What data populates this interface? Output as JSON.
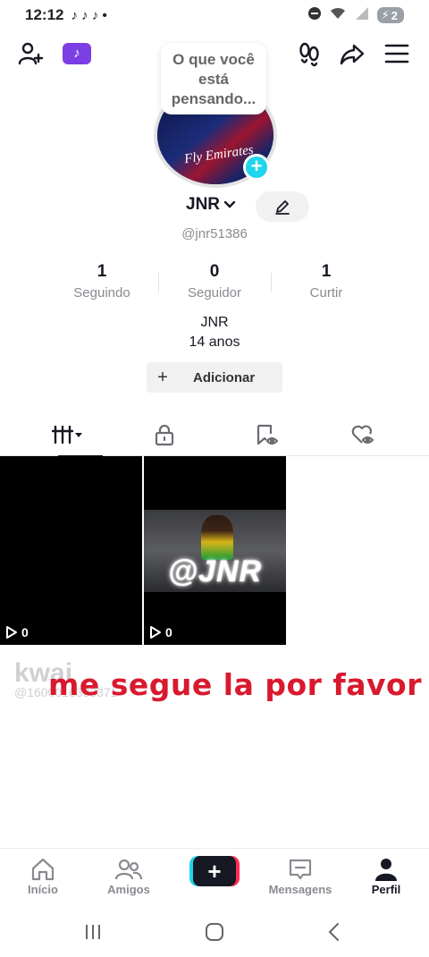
{
  "status_bar": {
    "time": "12:12",
    "notif_icons": "♪ ♪ ♪ •",
    "battery": "2"
  },
  "thought_bubble": "O que você está pensando...",
  "avatar": {
    "shirt_text": "Fly Emirates"
  },
  "profile": {
    "nickname": "JNR",
    "username": "@jnr51386"
  },
  "stats": [
    {
      "value": "1",
      "label": "Seguindo"
    },
    {
      "value": "0",
      "label": "Seguidor"
    },
    {
      "value": "1",
      "label": "Curtir"
    }
  ],
  "bio": {
    "line1": "JNR",
    "line2": "14 anos"
  },
  "add_bio": {
    "plus": "+",
    "label": "Adicionar"
  },
  "videos": [
    {
      "plays": "0",
      "overlay_tag": ""
    },
    {
      "plays": "0",
      "overlay_tag": "@JNR"
    }
  ],
  "watermark": {
    "logo": "kwai",
    "id": "@1600016383371"
  },
  "overlay_text": "me segue la por favor",
  "bottom_nav": [
    {
      "label": "Início"
    },
    {
      "label": "Amigos"
    },
    {
      "label": "+"
    },
    {
      "label": "Mensagens"
    },
    {
      "label": "Perfil"
    }
  ],
  "colors": {
    "accent_cyan": "#20d5ec",
    "accent_red": "#fe2c55",
    "overlay_red": "#d9192e",
    "text_dark": "#161823",
    "text_muted": "#8a8b91"
  }
}
